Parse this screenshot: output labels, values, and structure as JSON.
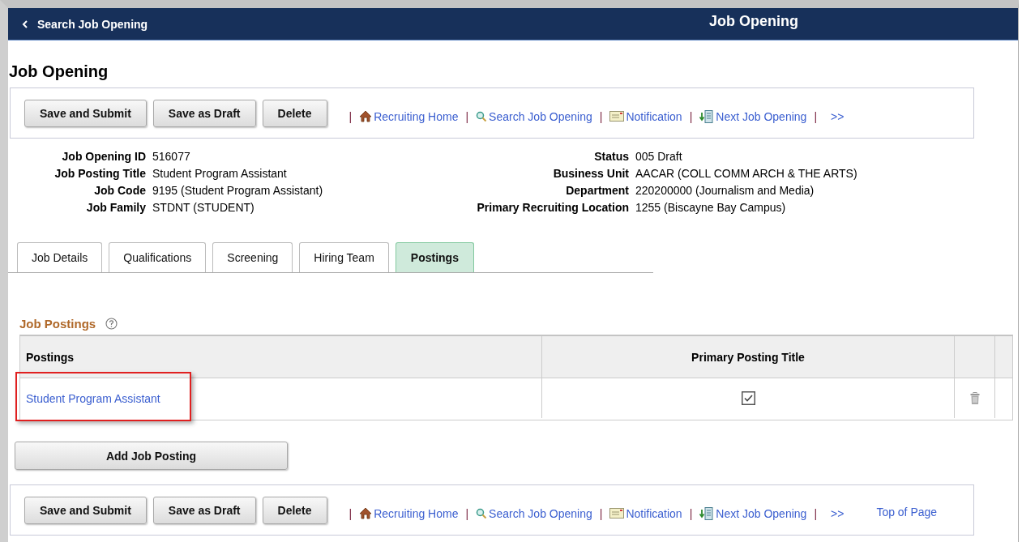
{
  "header": {
    "back_label": "Search Job Opening",
    "title": "Job Opening"
  },
  "page_title": "Job Opening",
  "toolbar_top": {
    "buttons": [
      "Save and Submit",
      "Save as Draft",
      "Delete"
    ],
    "links": [
      {
        "separator": "|",
        "label": "Recruiting Home"
      },
      {
        "separator": "|",
        "label": "Search Job Opening"
      },
      {
        "separator": "|",
        "label": "Notification"
      },
      {
        "separator": "|",
        "label": "Next Job Opening"
      },
      {
        "separator": "|",
        "label": ">>"
      }
    ]
  },
  "fields_left": [
    {
      "label": "Job Opening ID",
      "value": "516077"
    },
    {
      "label": "Job Posting Title",
      "value": "Student Program Assistant"
    },
    {
      "label": "Job Code",
      "value": "9195 (Student Program Assistant)"
    },
    {
      "label": "Job Family",
      "value": "STDNT (STUDENT)"
    }
  ],
  "fields_right": [
    {
      "label": "Status",
      "value": "005 Draft"
    },
    {
      "label": "Business Unit",
      "value": "AACAR (COLL COMM ARCH & THE ARTS)"
    },
    {
      "label": "Department",
      "value": "220200000 (Journalism and Media)"
    },
    {
      "label": "Primary Recruiting Location",
      "value": "1255 (Biscayne Bay Campus)"
    }
  ],
  "tabs": [
    {
      "label": "Job Details",
      "selected": false
    },
    {
      "label": "Qualifications",
      "selected": false
    },
    {
      "label": "Screening",
      "selected": false
    },
    {
      "label": "Hiring Team",
      "selected": false
    },
    {
      "label": "Postings",
      "selected": true
    }
  ],
  "section_title": "Job Postings",
  "table": {
    "columns": [
      "Postings",
      "Primary Posting Title"
    ],
    "rows": [
      {
        "posting": "Student Program Assistant",
        "primary": true,
        "highlighted": true
      }
    ]
  },
  "add_button": "Add Job Posting",
  "toolbar_bottom": {
    "buttons": [
      "Save and Submit",
      "Save as Draft",
      "Delete"
    ],
    "links": [
      {
        "separator": "|",
        "label": "Recruiting Home"
      },
      {
        "separator": "|",
        "label": "Search Job Opening"
      },
      {
        "separator": "|",
        "label": "Notification"
      },
      {
        "separator": "|",
        "label": "Next Job Opening"
      },
      {
        "separator": "|",
        "label": ">>"
      }
    ],
    "top_link": "Top of Page"
  }
}
